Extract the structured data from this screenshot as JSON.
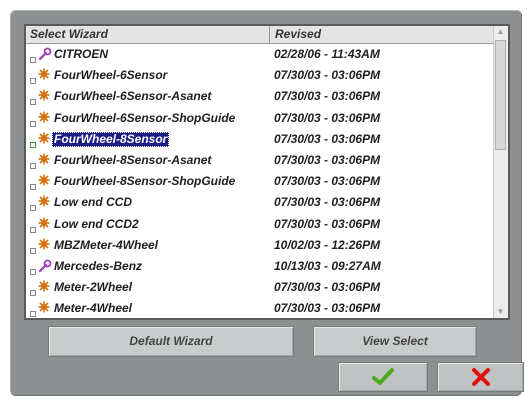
{
  "wizard_list": {
    "header": {
      "name": "Select Wizard",
      "revised": "Revised"
    },
    "rows": [
      {
        "name": "CITROEN",
        "revised": "02/28/06  - 11:43AM",
        "icon": "wrench-icon",
        "selected": false
      },
      {
        "name": "FourWheel-6Sensor",
        "revised": "07/30/03  - 03:06PM",
        "icon": "wheel-icon",
        "selected": false
      },
      {
        "name": "FourWheel-6Sensor-Asanet",
        "revised": "07/30/03  - 03:06PM",
        "icon": "wheel-icon",
        "selected": false
      },
      {
        "name": "FourWheel-6Sensor-ShopGuide",
        "revised": "07/30/03  - 03:06PM",
        "icon": "wheel-icon",
        "selected": false
      },
      {
        "name": "FourWheel-8Sensor",
        "revised": "07/30/03  - 03:06PM",
        "icon": "wheel-icon",
        "selected": true
      },
      {
        "name": "FourWheel-8Sensor-Asanet",
        "revised": "07/30/03  - 03:06PM",
        "icon": "wheel-icon",
        "selected": false
      },
      {
        "name": "FourWheel-8Sensor-ShopGuide",
        "revised": "07/30/03  - 03:06PM",
        "icon": "wheel-icon",
        "selected": false
      },
      {
        "name": "Low end CCD",
        "revised": "07/30/03  - 03:06PM",
        "icon": "wheel-icon",
        "selected": false
      },
      {
        "name": "Low end CCD2",
        "revised": "07/30/03  - 03:06PM",
        "icon": "wheel-icon",
        "selected": false
      },
      {
        "name": "MBZMeter-4Wheel",
        "revised": "10/02/03  - 12:26PM",
        "icon": "wheel-icon",
        "selected": false
      },
      {
        "name": "Mercedes-Benz",
        "revised": "10/13/03  - 09:27AM",
        "icon": "wrench-icon",
        "selected": false
      },
      {
        "name": "Meter-2Wheel",
        "revised": "07/30/03  - 03:06PM",
        "icon": "wheel-icon",
        "selected": false
      },
      {
        "name": "Meter-4Wheel",
        "revised": "07/30/03  - 03:06PM",
        "icon": "wheel-icon",
        "selected": false
      }
    ]
  },
  "buttons": {
    "default_wizard": "Default Wizard",
    "view_select": "View Select",
    "ok_icon": "checkmark-icon",
    "cancel_icon": "x-icon"
  },
  "colors": {
    "dialog_bg": "#8d9090",
    "selection": "#1b1b84",
    "ok_green": "#4caa22",
    "cancel_red": "#e01010"
  }
}
